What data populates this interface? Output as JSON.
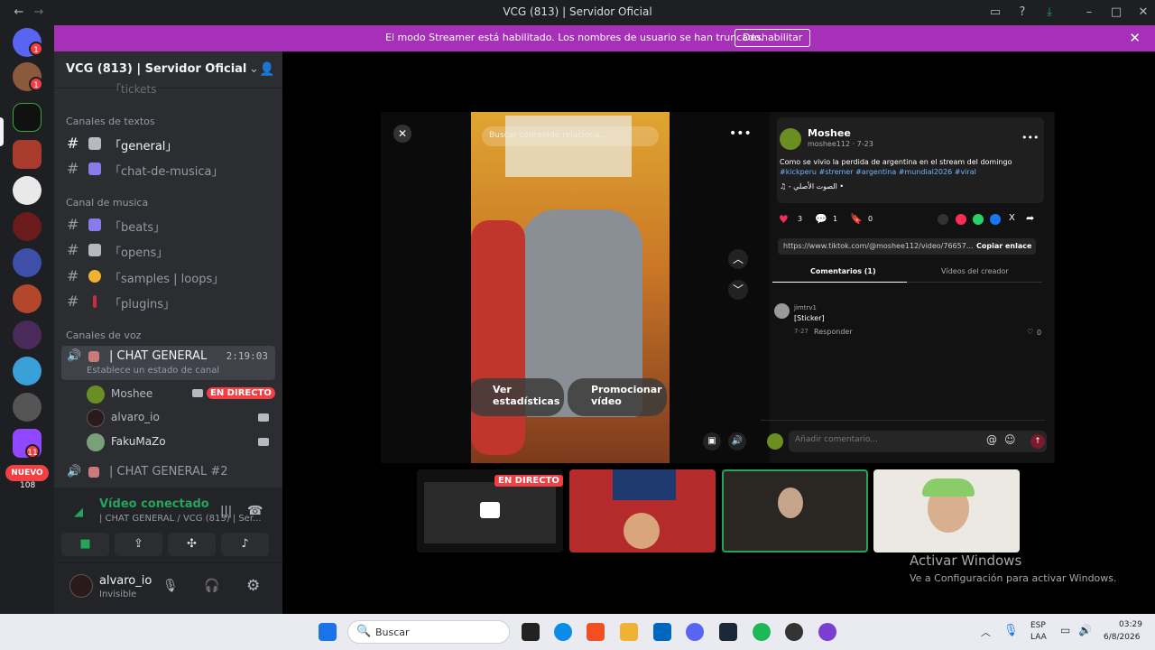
{
  "window": {
    "title": "VCG (813) | Servidor Oficial"
  },
  "banner": {
    "text": "El modo Streamer está habilitado. Los nombres de usuario se han truncado.",
    "button": "Deshabilitar"
  },
  "rail": {
    "badges": [
      "1",
      "1",
      "11",
      "108"
    ],
    "new_label": "NUEVO"
  },
  "sidebar": {
    "server_name": "VCG (813) | Servidor Oficial",
    "partial_channel": "「tickets",
    "categories": {
      "text": "Canales de textos",
      "music": "Canal de musica",
      "voice": "Canales de voz"
    },
    "text_channels": [
      "「general」",
      "「chat-de-musica」"
    ],
    "music_channels": [
      "「beats」",
      "「opens」",
      "「samples | loops」",
      "「plugins」"
    ],
    "voice_channel": {
      "name": "| CHAT GENERAL",
      "timer": "2:19:03",
      "status_hint": "Establece un estado de canal"
    },
    "voice_users": [
      "Moshee",
      "alvaro_io",
      "FakuMaZo"
    ],
    "live_label": "EN DIRECTO",
    "voice_channel_2": "| CHAT GENERAL #2"
  },
  "connection": {
    "status": "Vídeo conectado",
    "location": "| CHAT GENERAL / VCG (813) | Ser..."
  },
  "user": {
    "name": "alvaro_io",
    "status": "Invisible"
  },
  "tiktok": {
    "search_placeholder": "Buscar contenido relaciona...",
    "author": "Moshee",
    "handle": "moshee112 · 7-23",
    "caption": "Como se vivio la perdida de argentina en el stream del domingo",
    "hashtags": "#kickperu #stremer #argentina #mundial2026 #viral",
    "music": "♫ - الصوت الأصلي •",
    "counts": {
      "likes": "3",
      "comments": "1",
      "saves": "0"
    },
    "url": "https://www.tiktok.com/@moshee112/video/76657...",
    "copy_link": "Copiar enlace",
    "tabs": [
      "Comentarios (1)",
      "Vídeos del creador"
    ],
    "comment": {
      "user": "jimtrv1",
      "text": "[Sticker]",
      "date": "7-27",
      "reply": "Responder",
      "likes": "0"
    },
    "input_placeholder": "Añadir comentario...",
    "overlay_buttons": [
      "Ver estadísticas",
      "Promocionar vídeo"
    ],
    "colors": {
      "accent": "#fe2c55",
      "hashtag": "#6fb4ff"
    }
  },
  "watermark": {
    "title": "Activar Windows",
    "sub": "Ve a Configuración para activar Windows."
  },
  "taskbar": {
    "search": "Buscar",
    "lang": "ESP",
    "lang2": "LAA",
    "time": "03:29",
    "date": "6/8/2026"
  }
}
